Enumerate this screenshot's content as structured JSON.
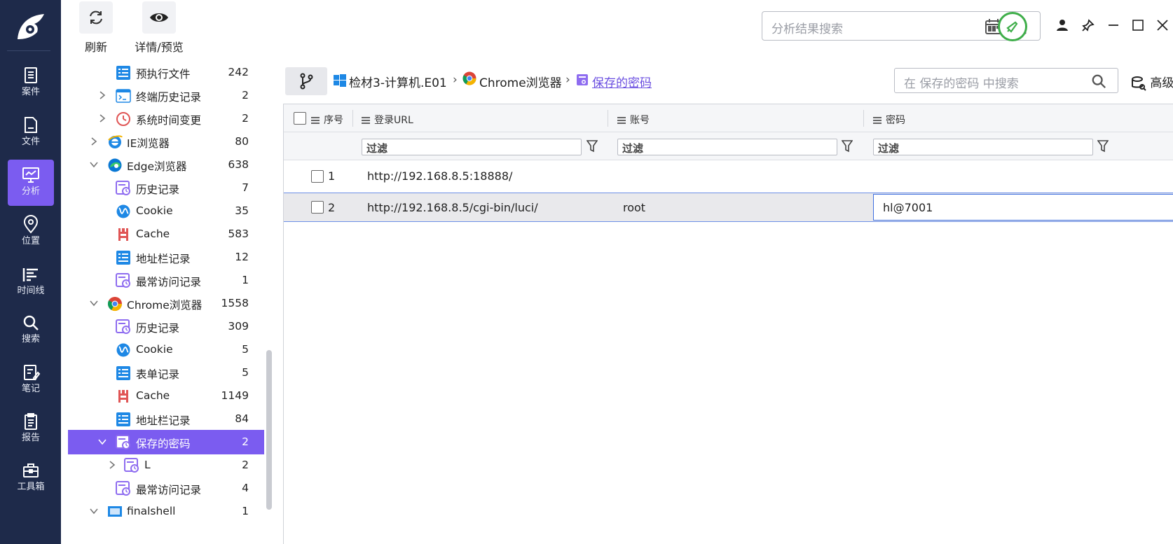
{
  "nav": {
    "items": [
      {
        "label": "案件",
        "icon": "case-icon"
      },
      {
        "label": "文件",
        "icon": "file-icon"
      },
      {
        "label": "分析",
        "icon": "analysis-icon",
        "active": true
      },
      {
        "label": "位置",
        "icon": "location-icon"
      },
      {
        "label": "时间线",
        "icon": "timeline-icon"
      },
      {
        "label": "搜索",
        "icon": "search-icon"
      },
      {
        "label": "笔记",
        "icon": "notes-icon"
      },
      {
        "label": "报告",
        "icon": "report-icon"
      },
      {
        "label": "工具箱",
        "icon": "toolbox-icon"
      }
    ]
  },
  "toolbar": {
    "refresh_label": "刷新",
    "preview_label": "详情/预览",
    "search_placeholder": "分析结果搜索"
  },
  "tree": {
    "items": [
      {
        "label": "预执行文件",
        "count": "242",
        "icon": "list-icon"
      },
      {
        "label": "终端历史记录",
        "count": "2",
        "icon": "terminal-icon"
      },
      {
        "label": "系统时间变更",
        "count": "2",
        "icon": "clock-icon"
      },
      {
        "label": "IE浏览器",
        "count": "80",
        "icon": "ie-icon"
      },
      {
        "label": "Edge浏览器",
        "count": "638",
        "icon": "edge-icon"
      },
      {
        "label": "历史记录",
        "count": "7",
        "icon": "history-icon"
      },
      {
        "label": "Cookie",
        "count": "35",
        "icon": "cookie-icon"
      },
      {
        "label": "Cache",
        "count": "583",
        "icon": "cache-icon"
      },
      {
        "label": "地址栏记录",
        "count": "12",
        "icon": "list-icon"
      },
      {
        "label": "最常访问记录",
        "count": "1",
        "icon": "history-icon"
      },
      {
        "label": "Chrome浏览器",
        "count": "1558",
        "icon": "chrome-icon"
      },
      {
        "label": "历史记录",
        "count": "309",
        "icon": "history-icon"
      },
      {
        "label": "Cookie",
        "count": "5",
        "icon": "cookie-icon"
      },
      {
        "label": "表单记录",
        "count": "5",
        "icon": "list-icon"
      },
      {
        "label": "Cache",
        "count": "1149",
        "icon": "cache-icon"
      },
      {
        "label": "地址栏记录",
        "count": "84",
        "icon": "list-icon"
      },
      {
        "label": "保存的密码",
        "count": "2",
        "icon": "history-icon",
        "selected": true
      },
      {
        "label": "L",
        "count": "2",
        "icon": "history-icon"
      },
      {
        "label": "最常访问记录",
        "count": "4",
        "icon": "history-icon"
      },
      {
        "label": "finalshell",
        "count": "1",
        "icon": "app-icon"
      }
    ]
  },
  "breadcrumb": {
    "items": [
      "检材3-计算机.E01",
      "Chrome浏览器",
      "保存的密码"
    ]
  },
  "local_search_placeholder": "在 保存的密码 中搜索",
  "advanced_label": "高级",
  "grid": {
    "columns": [
      "序号",
      "登录URL",
      "账号",
      "密码"
    ],
    "filter_placeholder": "过滤",
    "rows": [
      {
        "index": "1",
        "url": "http://192.168.8.5:18888/",
        "account": "",
        "password": ""
      },
      {
        "index": "2",
        "url": "http://192.168.8.5/cgi-bin/luci/",
        "account": "root",
        "password": "hl@7001"
      }
    ]
  },
  "colors": {
    "nav_bg": "#1e2a4a",
    "accent": "#7b5cf0",
    "selection_border": "#3e6fe0"
  }
}
